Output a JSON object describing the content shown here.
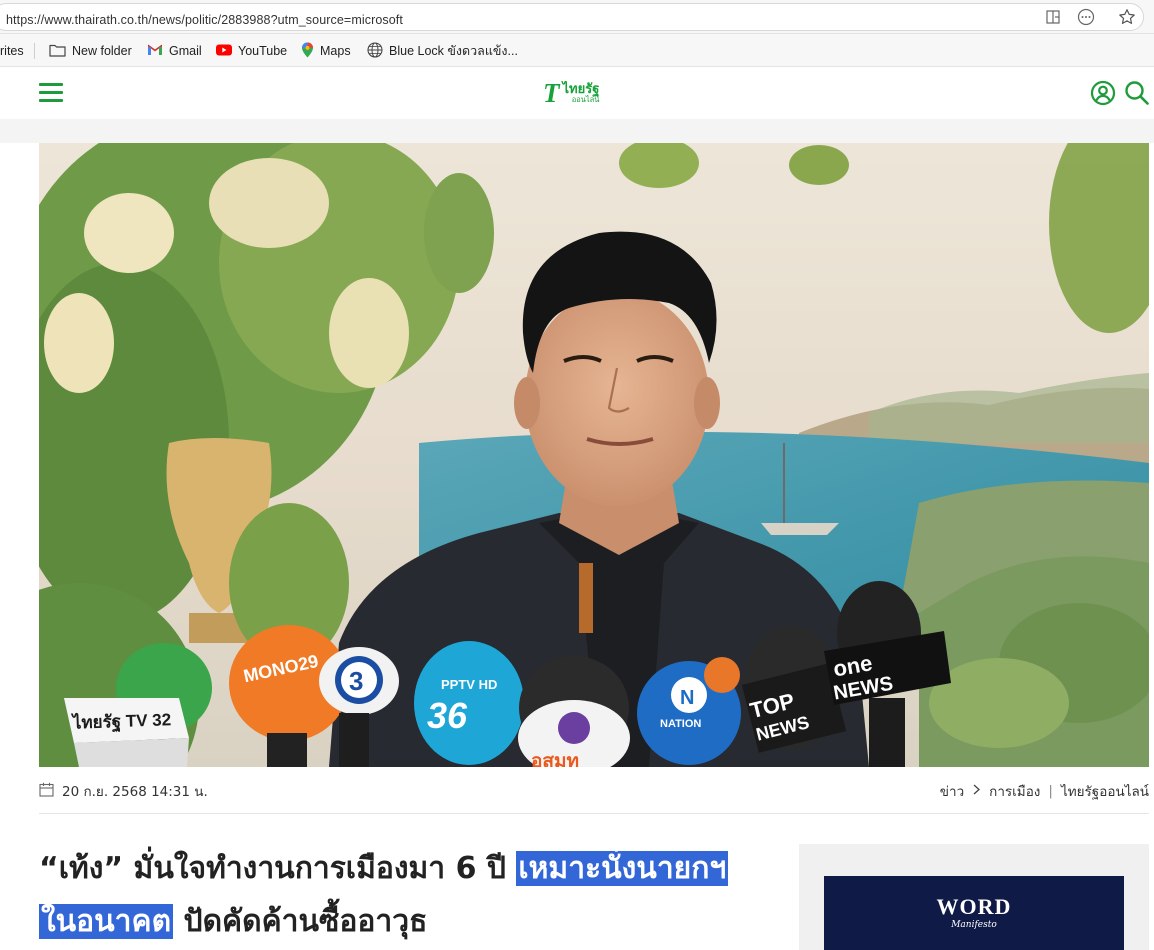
{
  "browser": {
    "url": "https://www.thairath.co.th/news/politic/2883988?utm_source=microsoft",
    "icons": [
      "split-screen-icon",
      "more-options-icon",
      "favorite-star-icon"
    ]
  },
  "bookmarks": {
    "favorites_fragment": "rites",
    "items": [
      {
        "label": "New folder",
        "icon": "folder-icon"
      },
      {
        "label": "Gmail",
        "icon": "gmail-icon"
      },
      {
        "label": "YouTube",
        "icon": "youtube-icon"
      },
      {
        "label": "Maps",
        "icon": "maps-icon"
      },
      {
        "label": "Blue Lock ขังดวลแข้ง...",
        "icon": "globe-icon"
      }
    ]
  },
  "site": {
    "logo_main": "ไทยรัฐ",
    "logo_sub": "ออนไลน์",
    "brand_color": "#1e9b3c"
  },
  "hero": {
    "mic_labels": [
      "ไทยรัฐ TV 32",
      "MONO29",
      "3",
      "PPTV HD 36",
      "อสมท",
      "NATION",
      "TOP NEWS",
      "one NEWS"
    ]
  },
  "article": {
    "date": "20 ก.ย. 2568 14:31 น.",
    "breadcrumb": [
      "ข่าว",
      "การเมือง"
    ],
    "source": "ไทยรัฐออนไลน์",
    "headline_part1": "“เท้ง” มั่นใจทำงานการเมืองมา 6 ปี ",
    "headline_selected_1": "เหมาะนั่งนายกฯ",
    "headline_selected_2": "ในอนาคต",
    "headline_part2": " ปัดคัดค้านซื้ออาวุธ"
  },
  "ad": {
    "title": "WORD",
    "subtitle": "Manifesto"
  }
}
